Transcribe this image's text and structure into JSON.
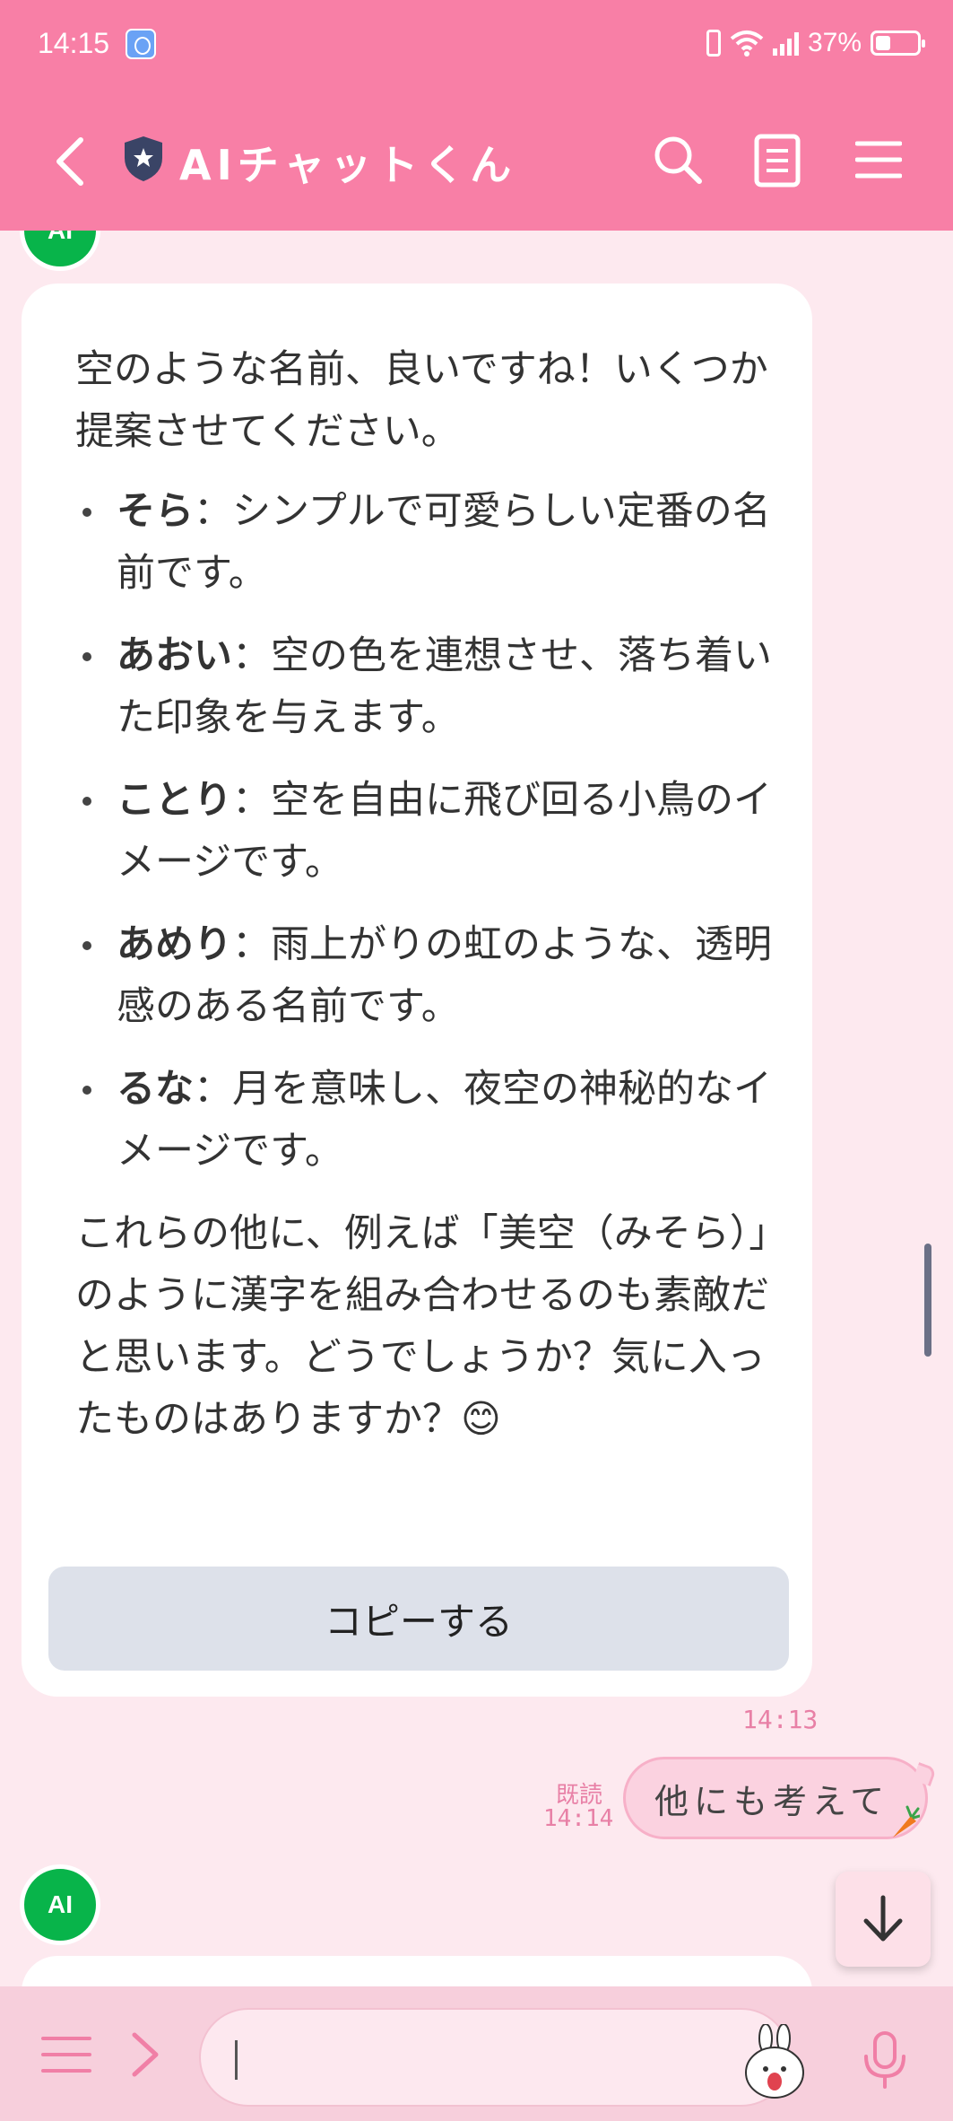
{
  "status_bar": {
    "time": "14:15",
    "battery_percent": "37%",
    "battery_level": 0.37
  },
  "header": {
    "title": "AIチャットくん",
    "icons": [
      "back-icon",
      "shield-icon",
      "search-icon",
      "notes-icon",
      "menu-icon"
    ]
  },
  "avatar": {
    "label": "AI"
  },
  "message": {
    "intro": "空のような名前、良いですね！いくつか提案させてください。",
    "suggestions": [
      {
        "name": "そら",
        "desc": "：シンプルで可愛らしい定番の名前です。"
      },
      {
        "name": "あおい",
        "desc": "：空の色を連想させ、落ち着いた印象を与えます。"
      },
      {
        "name": "ことり",
        "desc": "：空を自由に飛び回る小鳥のイメージです。"
      },
      {
        "name": "あめり",
        "desc": "：雨上がりの虹のような、透明感のある名前です。"
      },
      {
        "name": "るな",
        "desc": "：月を意味し、夜空の神秘的なイメージです。"
      }
    ],
    "outro": "これらの他に、例えば「美空（みそら）」のように漢字を組み合わせるのも素敵だと思います。どうでしょうか？気に入ったものはありますか？😊",
    "copy_label": "コピーする",
    "time": "14:13"
  },
  "user_message": {
    "text": "他にも考えて",
    "read_label": "既読",
    "time": "14:14"
  },
  "input": {
    "placeholder": "",
    "value": ""
  },
  "colors": {
    "header": "#f87fa6",
    "background": "#fde9ef",
    "avatar": "#08b44a",
    "user_bubble": "#fbd2e0",
    "copy_button": "#dde1ea",
    "timestamp": "#e880a6"
  }
}
